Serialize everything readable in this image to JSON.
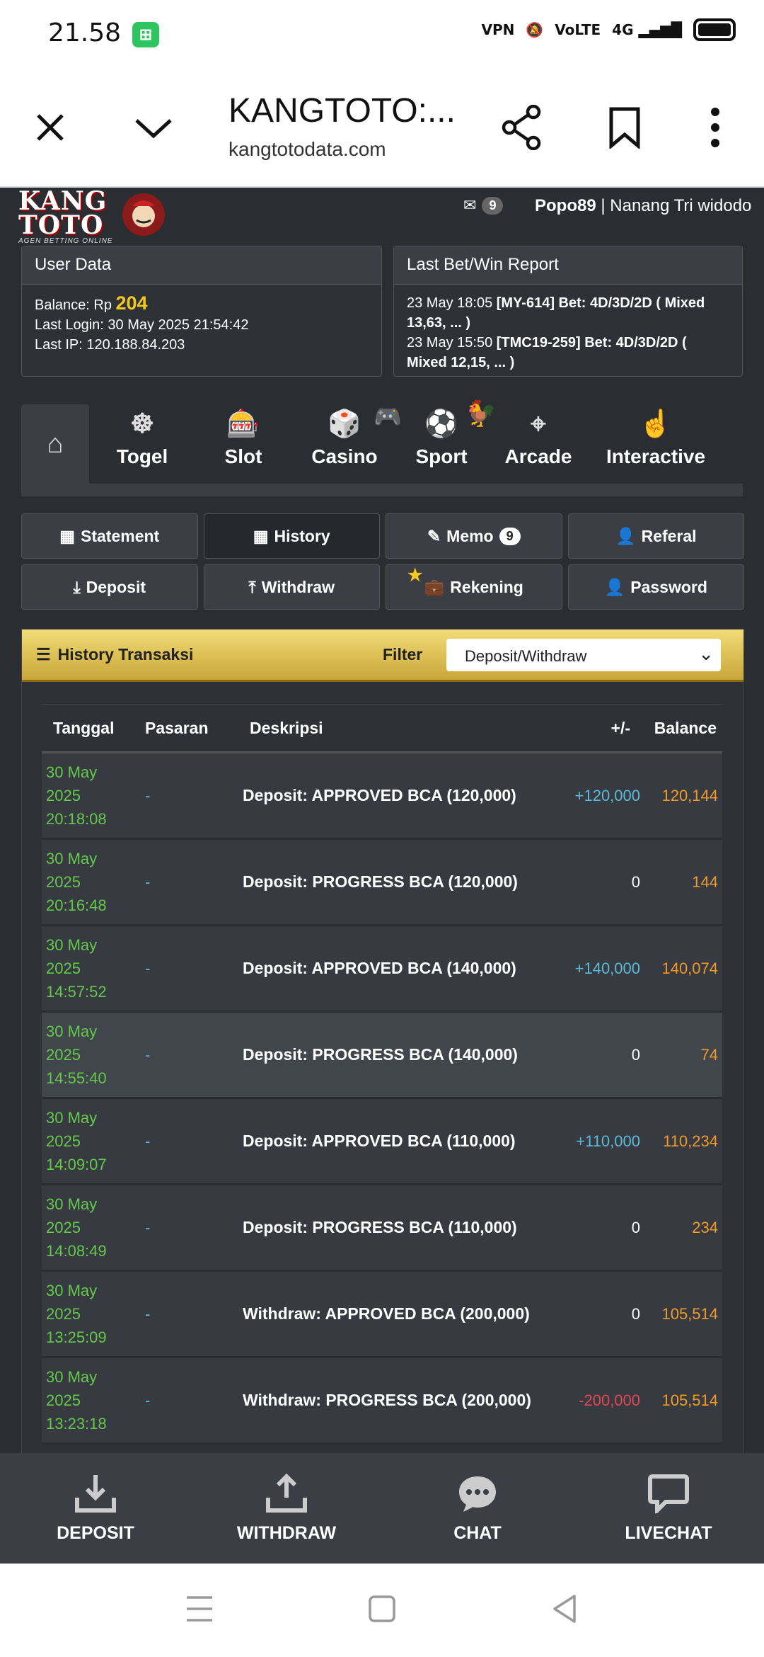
{
  "status": {
    "time": "21.58",
    "network": "4G"
  },
  "browser": {
    "title": "KANGTOTO:...",
    "url": "kangtotodata.com"
  },
  "brand": {
    "line1": "KANG",
    "line2": "TOTO",
    "tagline": "AGEN BETTING ONLINE"
  },
  "header": {
    "mail_count": "9",
    "username": "Popo89",
    "separator": " | ",
    "fullname": "Nanang Tri widodo"
  },
  "user_data": {
    "title": "User Data",
    "balance_label": "Balance: Rp ",
    "balance": "204",
    "last_login": "Last Login: 30 May 2025 21:54:42",
    "last_ip": "Last IP: 120.188.84.203"
  },
  "report": {
    "title": "Last Bet/Win Report",
    "lines": [
      {
        "time": "23 May 18:05 ",
        "text": "[MY-614] Bet: 4D/3D/2D ( Mixed 13,63, ... )"
      },
      {
        "time": "23 May 15:50 ",
        "text": "[TMC19-259] Bet: 4D/3D/2D ( Mixed 12,15, ... )"
      }
    ]
  },
  "nav": {
    "togel": "Togel",
    "slot": "Slot",
    "casino": "Casino",
    "sport": "Sport",
    "arcade": "Arcade",
    "interactive": "Interactive"
  },
  "buttons": {
    "statement": "Statement",
    "history": "History",
    "memo": "Memo",
    "memo_count": "9",
    "referal": "Referal",
    "deposit": "Deposit",
    "withdraw": "Withdraw",
    "rekening": "Rekening",
    "password": "Password"
  },
  "history": {
    "title": "History Transaksi",
    "filter_label": "Filter",
    "filter_value": "Deposit/Withdraw",
    "headers": {
      "tanggal": "Tanggal",
      "pasaran": "Pasaran",
      "deskripsi": "Deskripsi",
      "plusminus": "+/-",
      "balance": "Balance"
    },
    "rows": [
      {
        "d1": "30 May",
        "d2": "2025",
        "d3": "20:18:08",
        "pasaran": "-",
        "desc": "Deposit: APPROVED BCA (120,000)",
        "amount": "+120,000",
        "balance": "120,144"
      },
      {
        "d1": "30 May",
        "d2": "2025",
        "d3": "20:16:48",
        "pasaran": "-",
        "desc": "Deposit: PROGRESS BCA (120,000)",
        "amount": "0",
        "balance": "144"
      },
      {
        "d1": "30 May",
        "d2": "2025",
        "d3": "14:57:52",
        "pasaran": "-",
        "desc": "Deposit: APPROVED BCA (140,000)",
        "amount": "+140,000",
        "balance": "140,074"
      },
      {
        "d1": "30 May",
        "d2": "2025",
        "d3": "14:55:40",
        "pasaran": "-",
        "desc": "Deposit: PROGRESS BCA (140,000)",
        "amount": "0",
        "balance": "74"
      },
      {
        "d1": "30 May",
        "d2": "2025",
        "d3": "14:09:07",
        "pasaran": "-",
        "desc": "Deposit: APPROVED BCA (110,000)",
        "amount": "+110,000",
        "balance": "110,234"
      },
      {
        "d1": "30 May",
        "d2": "2025",
        "d3": "14:08:49",
        "pasaran": "-",
        "desc": "Deposit: PROGRESS BCA (110,000)",
        "amount": "0",
        "balance": "234"
      },
      {
        "d1": "30 May",
        "d2": "2025",
        "d3": "13:25:09",
        "pasaran": "-",
        "desc": "Withdraw: APPROVED BCA (200,000)",
        "amount": "0",
        "balance": "105,514"
      },
      {
        "d1": "30 May",
        "d2": "2025",
        "d3": "13:23:18",
        "pasaran": "-",
        "desc": "Withdraw: PROGRESS BCA (200,000)",
        "amount": "-200,000",
        "balance": "105,514"
      }
    ]
  },
  "bottom": {
    "deposit": "DEPOSIT",
    "withdraw": "WITHDRAW",
    "chat": "CHAT",
    "livechat": "LIVECHAT"
  },
  "colors": {
    "accent_gold": "#f4c81c",
    "positive": "#5bbbd8",
    "negative": "#e0484f",
    "balance": "#f09a28",
    "date": "#63c94a"
  }
}
